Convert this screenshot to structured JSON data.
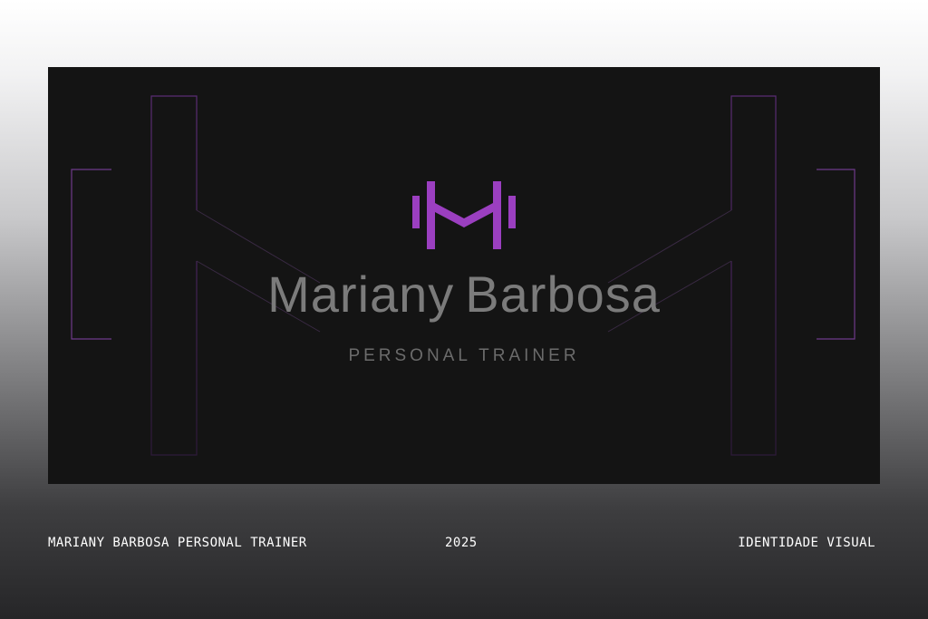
{
  "brand": {
    "first_name": "Mariany",
    "last_name": "Barbosa",
    "tagline": "PERSONAL TRAINER",
    "logo_icon": "dumbbell-m-monogram-icon"
  },
  "footer": {
    "project": "MARIANY BARBOSA PERSONAL TRAINER",
    "year": "2025",
    "category": "IDENTIDADE VISUAL"
  },
  "colors": {
    "accent": "#9b3fc0",
    "card_background": "#141414",
    "brand_text": "#7b7b7b",
    "tagline_text": "#6b6b6b",
    "footer_text": "#ffffff"
  }
}
